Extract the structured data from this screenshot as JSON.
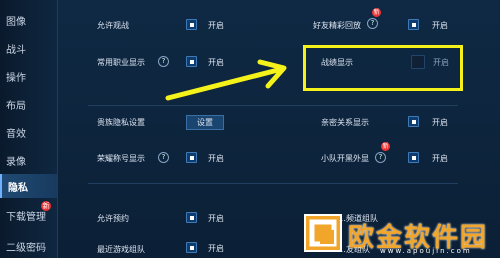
{
  "sidebar": {
    "items": [
      {
        "label": "图像"
      },
      {
        "label": "战斗"
      },
      {
        "label": "操作"
      },
      {
        "label": "布局"
      },
      {
        "label": "音效"
      },
      {
        "label": "录像"
      },
      {
        "label": "隐私"
      },
      {
        "label": "下载管理",
        "badge": "新"
      },
      {
        "label": "二级密码"
      }
    ]
  },
  "settings": {
    "allow_watch": {
      "label": "允许观战",
      "value": "开启"
    },
    "friend_highlight": {
      "label": "好友精彩回放",
      "badge": "新",
      "value": "开启"
    },
    "common_role": {
      "label": "常用职业显示",
      "value": "开启"
    },
    "battle_record": {
      "label": "战绩显示",
      "value": "开启"
    },
    "noble_privacy": {
      "label": "贵族隐私设置",
      "button": "设置"
    },
    "close_relation": {
      "label": "亲密关系显示",
      "value": "开启"
    },
    "honor_title": {
      "label": "荣耀称号显示",
      "value": "开启"
    },
    "squad_skin": {
      "label": "小队开黑外显",
      "badge": "新",
      "value": "开启"
    },
    "allow_reservation": {
      "label": "允许预约",
      "value": "开启"
    },
    "recent_team": {
      "label": "最近游戏组队",
      "value": "开启"
    },
    "partial_right_1": {
      "label": "…频道组队"
    },
    "partial_right_2": {
      "label": "…友组队"
    }
  },
  "watermark": {
    "text": "欧金软件园",
    "url": "www.apoujin.com"
  },
  "colors": {
    "highlight": "#f4f21a",
    "accent": "#3e79b8"
  }
}
